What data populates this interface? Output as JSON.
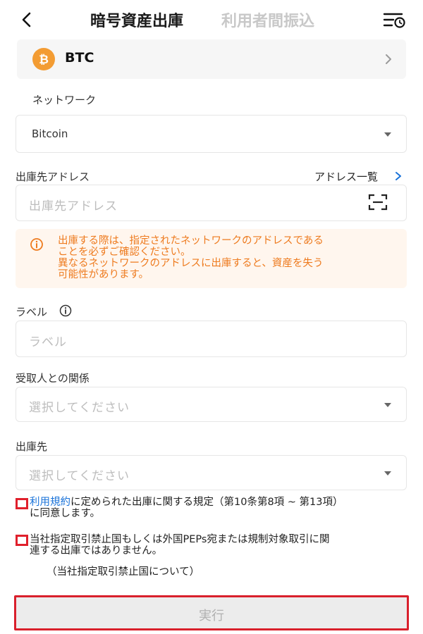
{
  "header": {
    "tab_active": "暗号資産出庫",
    "tab_inactive": "利用者間振込",
    "icons": {
      "back": "chevron-left-icon",
      "history": "history-filter-icon"
    }
  },
  "asset": {
    "name": "BTC",
    "logo_color": "#f39c33",
    "icon": "bitcoin-icon"
  },
  "network": {
    "label": "ネットワーク",
    "value": "Bitcoin"
  },
  "address": {
    "label": "出庫先アドレス",
    "list_link": "アドレス一覧",
    "placeholder": "出庫先アドレス",
    "scan_icon": "qr-scan-icon"
  },
  "warning": {
    "text": "出庫する際は、指定されたネットワークのアドレスである\nことを必ずご確認ください。\n異なるネットワークのアドレスに出庫すると、資産を失う\n可能性があります。",
    "color": "#ee7b1f"
  },
  "label_field": {
    "label": "ラベル",
    "placeholder": "ラベル"
  },
  "relation": {
    "label": "受取人との関係",
    "placeholder": "選択してください"
  },
  "destination": {
    "label": "出庫先",
    "placeholder": "選択してください"
  },
  "agreements": {
    "terms_link": "利用規約",
    "terms_text_1": "に定められた出庫に関する規定（第10条第8項 ~ 第13項）",
    "terms_text_2": "に同意します。",
    "sanction_text_1": "当社指定取引禁止国もしくは外国PEPs宛または規制対象取引に関",
    "sanction_text_2": "連する出庫ではありません。",
    "sanction_note": "（当社指定取引禁止国について）"
  },
  "execute": {
    "label": "実行"
  },
  "colors": {
    "highlight": "#e0202c",
    "link": "#1a73d9",
    "disabled_button": "#ececec"
  }
}
